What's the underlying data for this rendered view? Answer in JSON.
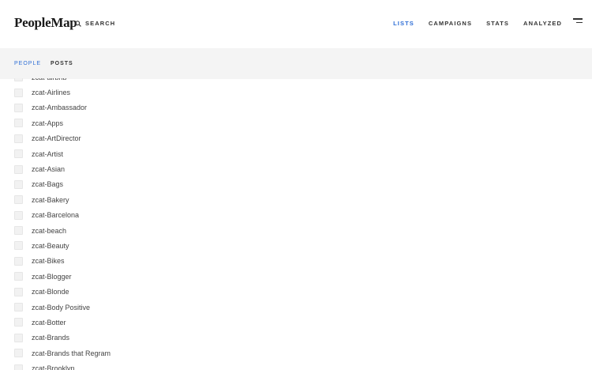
{
  "header": {
    "logo": "PeopleMap",
    "search_label": "SEARCH",
    "nav": [
      {
        "label": "LISTS",
        "active": true
      },
      {
        "label": "CAMPAIGNS",
        "active": false
      },
      {
        "label": "STATS",
        "active": false
      },
      {
        "label": "ANALYZED",
        "active": false
      }
    ]
  },
  "subnav": {
    "tabs": [
      {
        "label": "PEOPLE",
        "active": true
      },
      {
        "label": "POSTS",
        "active": false
      }
    ]
  },
  "list": {
    "items": [
      "zcat-airbnb",
      "zcat-Airlines",
      "zcat-Ambassador",
      "zcat-Apps",
      "zcat-ArtDirector",
      "zcat-Artist",
      "zcat-Asian",
      "zcat-Bags",
      "zcat-Bakery",
      "zcat-Barcelona",
      "zcat-beach",
      "zcat-Beauty",
      "zcat-Bikes",
      "zcat-Blogger",
      "zcat-Blonde",
      "zcat-Body Positive",
      "zcat-Botter",
      "zcat-Brands",
      "zcat-Brands that Regram",
      "zcat-Brooklyn"
    ]
  },
  "colors": {
    "accent": "#2f6fd6",
    "subbar_bg": "#f4f4f4"
  }
}
